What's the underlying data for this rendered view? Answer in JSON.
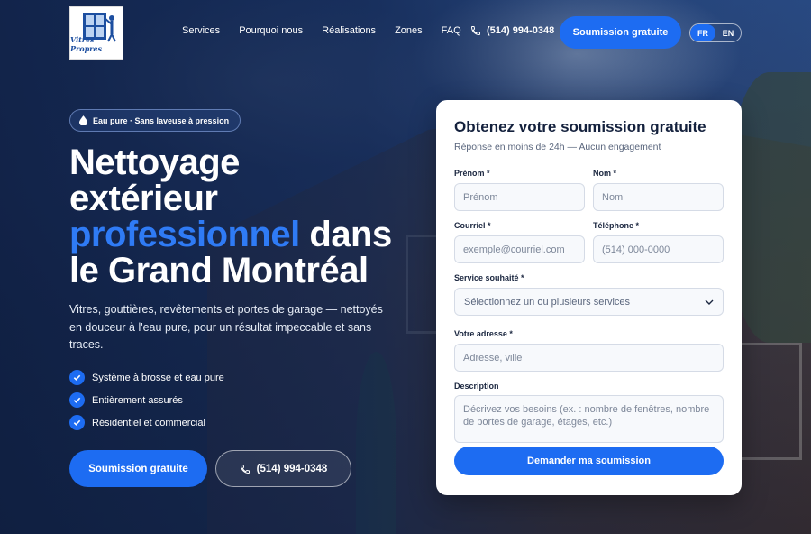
{
  "logo": {
    "text": "Vitres Propres"
  },
  "nav": {
    "items": [
      "Services",
      "Pourquoi nous",
      "Réalisations",
      "Zones",
      "FAQ"
    ],
    "phone": "(514) 994-0348",
    "cta": "Soumission gratuite",
    "lang": {
      "fr": "FR",
      "en": "EN",
      "active": "FR"
    }
  },
  "hero": {
    "badge": "Eau pure · Sans laveuse à pression",
    "title_line1": "Nettoyage",
    "title_line2": "extérieur",
    "title_accent": "professionnel",
    "title_after_accent": " dans",
    "title_line4": "le Grand Montréal",
    "description": "Vitres, gouttières, revêtements et portes de garage — nettoyés en douceur à l'eau pure, pour un résultat impeccable et sans traces.",
    "features": [
      "Système à brosse et eau pure",
      "Entièrement assurés",
      "Résidentiel et commercial"
    ],
    "cta_primary": "Soumission gratuite",
    "cta_phone": "(514) 994-0348"
  },
  "form": {
    "title": "Obtenez votre soumission gratuite",
    "subtitle": "Réponse en moins de 24h — Aucun engagement",
    "first_name": {
      "label": "Prénom *",
      "placeholder": "Prénom"
    },
    "last_name": {
      "label": "Nom *",
      "placeholder": "Nom"
    },
    "email": {
      "label": "Courriel *",
      "placeholder": "exemple@courriel.com"
    },
    "phone": {
      "label": "Téléphone *",
      "placeholder": "(514) 000-0000"
    },
    "service": {
      "label": "Service souhaité *",
      "placeholder": "Sélectionnez un ou plusieurs services"
    },
    "address": {
      "label": "Votre adresse *",
      "placeholder": "Adresse, ville"
    },
    "description": {
      "label": "Description",
      "placeholder": "Décrivez vos besoins (ex. : nombre de fenêtres, nombre de portes de garage, étages, etc.)"
    },
    "submit": "Demander ma soumission"
  },
  "colors": {
    "accent": "#1d6cf2",
    "accent_text": "#2f7bf5",
    "card_bg": "#ffffff"
  }
}
